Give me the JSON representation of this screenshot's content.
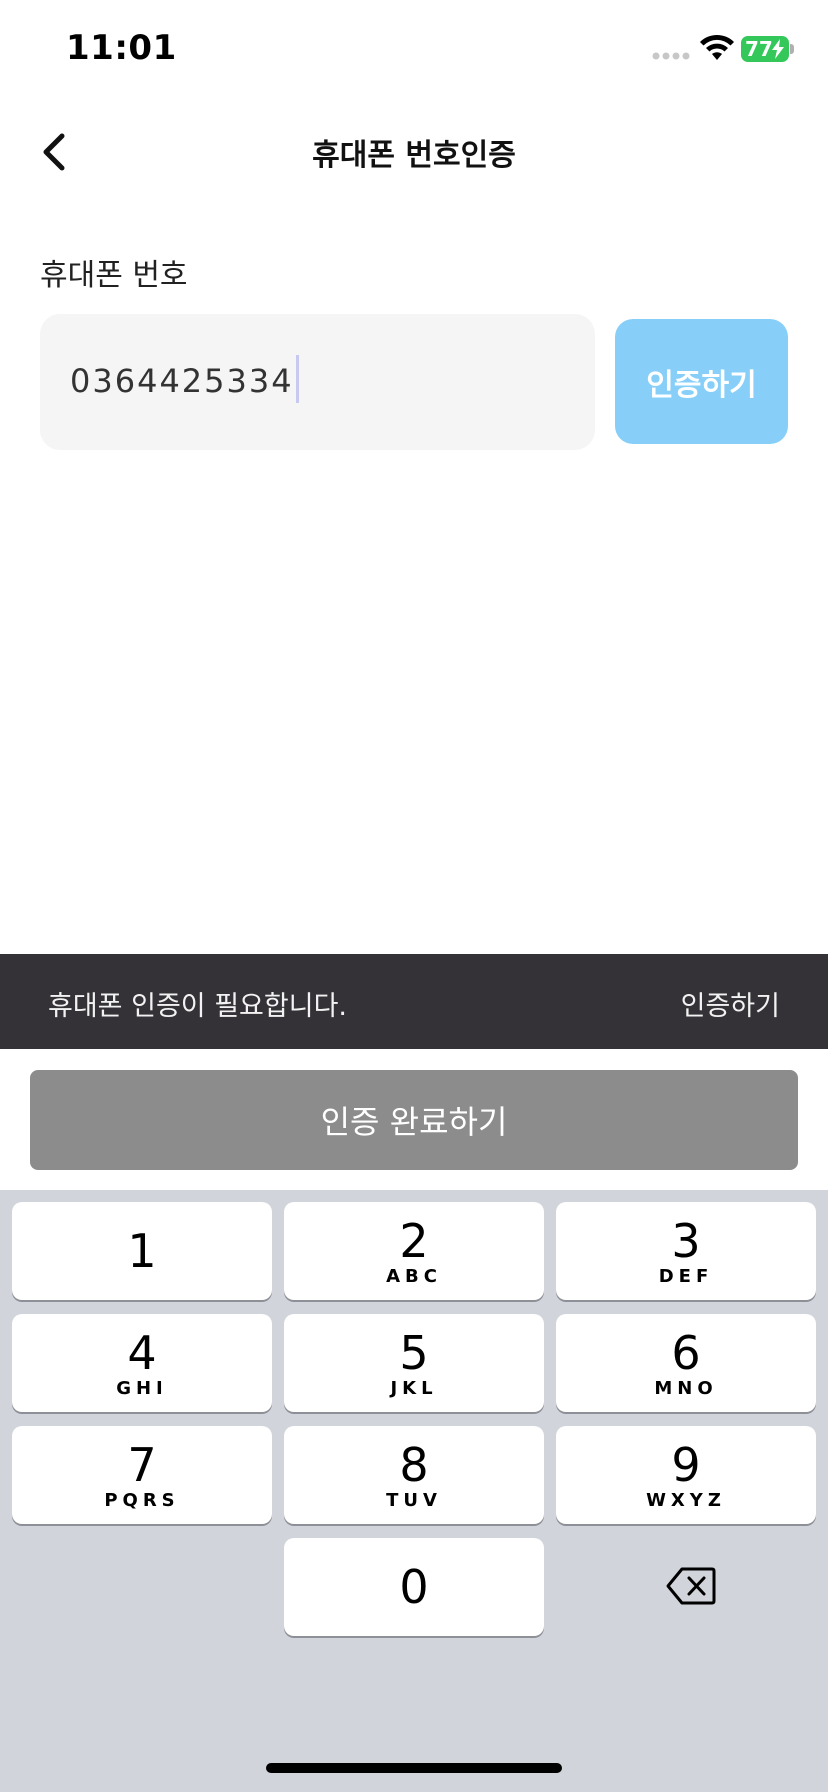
{
  "status_bar": {
    "time": "11:01",
    "battery_level": "77",
    "battery_color": "#34c759"
  },
  "header": {
    "title": "휴대폰 번호인증",
    "back_icon": "chevron-left-icon"
  },
  "phone_field": {
    "label": "휴대폰 번호",
    "value": "0364425334"
  },
  "verify_button": {
    "label": "인증하기",
    "color": "#87cff8"
  },
  "snackbar": {
    "message": "휴대폰 인증이 필요합니다.",
    "action": "인증하기"
  },
  "complete_button": {
    "label": "인증 완료하기",
    "color": "#8c8c8c"
  },
  "keypad": {
    "keys": [
      {
        "digit": "1",
        "letters": ""
      },
      {
        "digit": "2",
        "letters": "ABC"
      },
      {
        "digit": "3",
        "letters": "DEF"
      },
      {
        "digit": "4",
        "letters": "GHI"
      },
      {
        "digit": "5",
        "letters": "JKL"
      },
      {
        "digit": "6",
        "letters": "MNO"
      },
      {
        "digit": "7",
        "letters": "PQRS"
      },
      {
        "digit": "8",
        "letters": "TUV"
      },
      {
        "digit": "9",
        "letters": "WXYZ"
      },
      {
        "digit": "0",
        "letters": ""
      }
    ],
    "delete_icon": "backspace-icon"
  }
}
